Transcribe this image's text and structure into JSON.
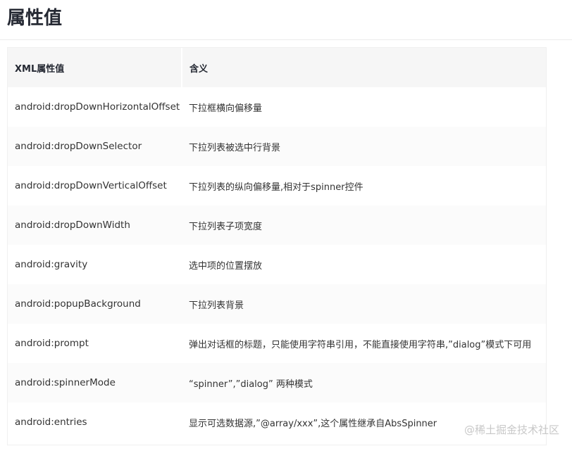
{
  "page": {
    "title": "属性值"
  },
  "table": {
    "headers": [
      "XML属性值",
      "含义"
    ],
    "rows": [
      [
        "android:dropDownHorizontalOffset",
        "下拉框横向偏移量"
      ],
      [
        "android:dropDownSelector",
        "下拉列表被选中行背景"
      ],
      [
        "android:dropDownVerticalOffset",
        "下拉列表的纵向偏移量,相对于spinner控件"
      ],
      [
        "android:dropDownWidth",
        "下拉列表子项宽度"
      ],
      [
        "android:gravity",
        "选中项的位置摆放"
      ],
      [
        "android:popupBackground",
        "下拉列表背景"
      ],
      [
        "android:prompt",
        "弹出对话框的标题，只能使用字符串引用，不能直接使用字符串,”dialog”模式下可用"
      ],
      [
        "android:spinnerMode",
        "“spinner”,”dialog” 两种模式"
      ],
      [
        "android:entries",
        "显示可选数据源,”@array/xxx”,这个属性继承自AbsSpinner"
      ]
    ]
  },
  "watermark": "@稀土掘金技术社区"
}
